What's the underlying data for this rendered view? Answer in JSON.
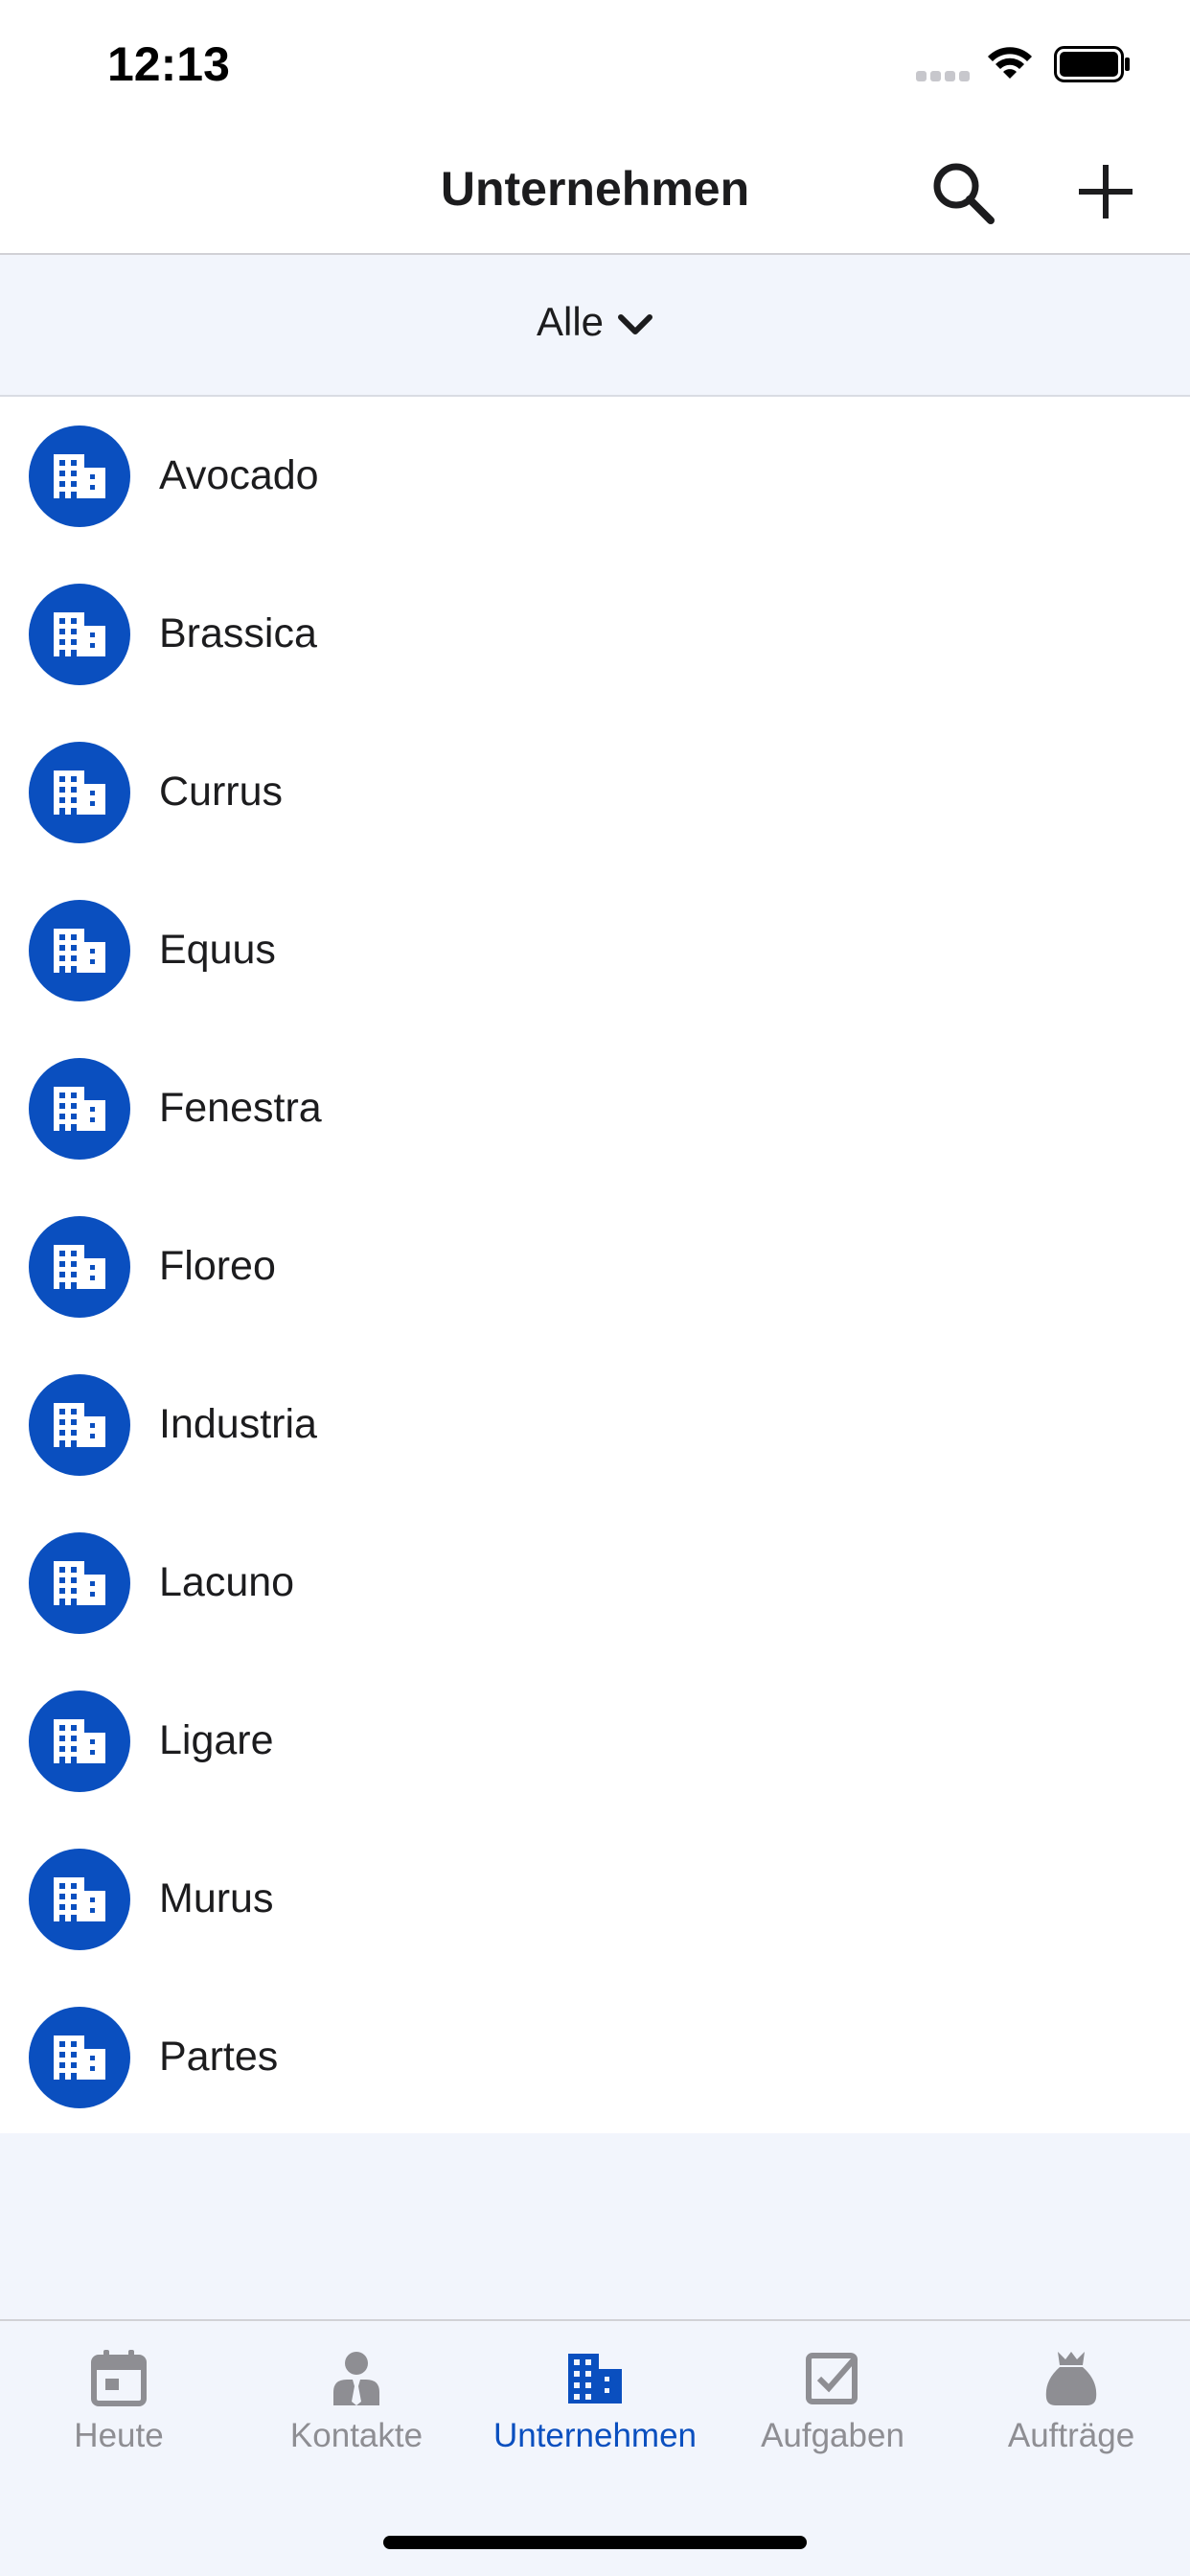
{
  "status_bar": {
    "time": "12:13"
  },
  "nav": {
    "title": "Unternehmen",
    "search_icon": "search-icon",
    "add_icon": "plus-icon"
  },
  "filter": {
    "label": "Alle"
  },
  "companies": [
    {
      "name": "Avocado"
    },
    {
      "name": "Brassica"
    },
    {
      "name": "Currus"
    },
    {
      "name": "Equus"
    },
    {
      "name": "Fenestra"
    },
    {
      "name": "Floreo"
    },
    {
      "name": "Industria"
    },
    {
      "name": "Lacuno"
    },
    {
      "name": "Ligare"
    },
    {
      "name": "Murus"
    },
    {
      "name": "Partes"
    }
  ],
  "tabs": [
    {
      "label": "Heute",
      "icon": "calendar-icon",
      "active": false
    },
    {
      "label": "Kontakte",
      "icon": "person-icon",
      "active": false
    },
    {
      "label": "Unternehmen",
      "icon": "building-icon",
      "active": true
    },
    {
      "label": "Aufgaben",
      "icon": "checkbox-icon",
      "active": false
    },
    {
      "label": "Aufträge",
      "icon": "money-bag-icon",
      "active": false
    }
  ],
  "colors": {
    "accent": "#0a4fbf",
    "tab_inactive": "#8e8e93",
    "background": "#f2f5fc"
  }
}
